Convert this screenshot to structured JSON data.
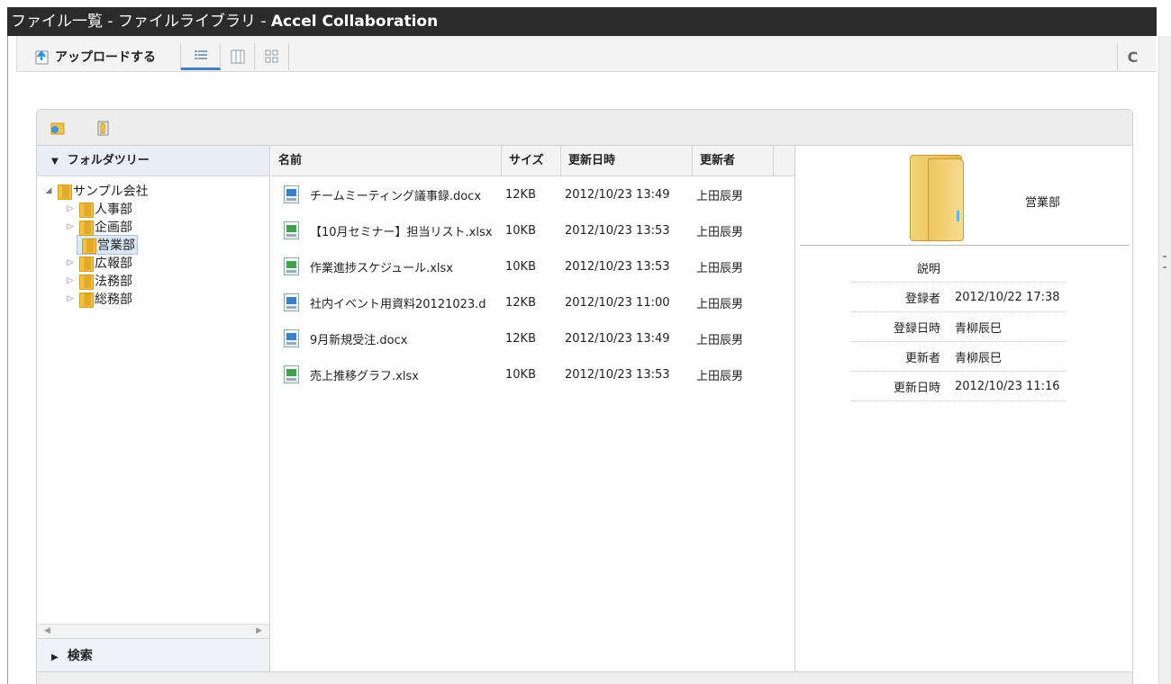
{
  "window": {
    "title_jp": "ファイル一覧 - ファイルライブラリ - ",
    "title_en": "Accel Collaboration"
  },
  "toolbar": {
    "upload_label": "アップロードする",
    "refresh_icon": "C"
  },
  "tree": {
    "header": "フォルダツリー",
    "root": "サンプル会社",
    "items": [
      {
        "label": "人事部"
      },
      {
        "label": "企画部"
      },
      {
        "label": "営業部"
      },
      {
        "label": "広報部"
      },
      {
        "label": "法務部"
      },
      {
        "label": "総務部"
      }
    ],
    "selected": "営業部",
    "search_label": "検索"
  },
  "files": {
    "columns": {
      "name": "名前",
      "size": "サイズ",
      "date": "更新日時",
      "user": "更新者"
    },
    "rows": [
      {
        "name": "チームミーティング議事録.docx",
        "size": "12KB",
        "date": "2012/10/23 13:49",
        "user": "上田辰男",
        "type": "word"
      },
      {
        "name": "【10月セミナー】担当リスト.xlsx",
        "size": "10KB",
        "date": "2012/10/23 13:53",
        "user": "上田辰男",
        "type": "xls"
      },
      {
        "name": "作業進捗スケジュール.xlsx",
        "size": "10KB",
        "date": "2012/10/23 13:53",
        "user": "上田辰男",
        "type": "xls"
      },
      {
        "name": "社内イベント用資料20121023.d",
        "size": "12KB",
        "date": "2012/10/23 11:00",
        "user": "上田辰男",
        "type": "word"
      },
      {
        "name": "9月新規受注.docx",
        "size": "12KB",
        "date": "2012/10/23 13:49",
        "user": "上田辰男",
        "type": "word"
      },
      {
        "name": "売上推移グラフ.xlsx",
        "size": "10KB",
        "date": "2012/10/23 13:53",
        "user": "上田辰男",
        "type": "xls"
      }
    ]
  },
  "detail": {
    "folder_name": "営業部",
    "props": [
      {
        "key": "説明",
        "value": ""
      },
      {
        "key": "登録者",
        "value": "2012/10/22 17:38"
      },
      {
        "key": "登録日時",
        "value": "青柳辰巳"
      },
      {
        "key": "更新者",
        "value": "青柳辰巳"
      },
      {
        "key": "更新日時",
        "value": "2012/10/23 11:16"
      }
    ]
  }
}
